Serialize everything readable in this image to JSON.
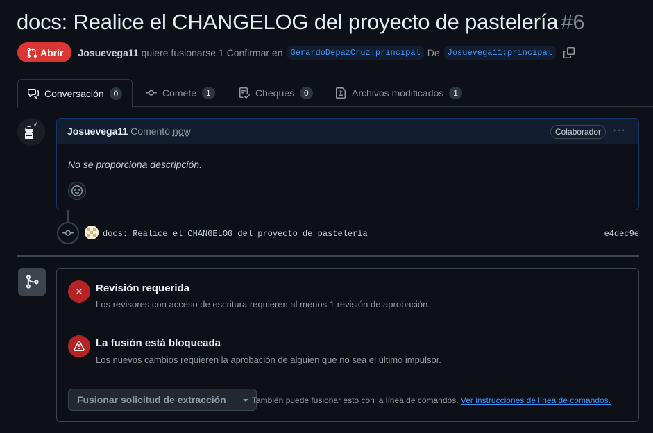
{
  "pr": {
    "title": "docs: Realice el CHANGELOG del proyecto de pastelería",
    "number": "#6",
    "state": "Abrir",
    "author": "Josuevega11",
    "action_text": "quiere fusionarse 1 Confirmar en",
    "base_branch": "GerardoDepazCruz:principal",
    "from_text": "De",
    "head_branch": "Josuevega11:principal"
  },
  "tabs": [
    {
      "label": "Conversación",
      "count": "0",
      "icon": "comment-discussion-icon"
    },
    {
      "label": "Comete",
      "count": "1",
      "icon": "git-commit-icon"
    },
    {
      "label": "Cheques",
      "count": "0",
      "icon": "checklist-icon"
    },
    {
      "label": "Archivos modificados",
      "count": "1",
      "icon": "file-diff-icon"
    }
  ],
  "comment": {
    "author": "Josuevega11",
    "verb": "Comentó",
    "time": "now",
    "role_badge": "Colaborador",
    "body": "No se proporciona descripción."
  },
  "commit": {
    "message": "docs: Realice el CHANGELOG del proyecto de pastelería",
    "sha": "e4dec9e"
  },
  "merge": {
    "review": {
      "title": "Revisión requerida",
      "desc": "Los revisores con acceso de escritura requieren al menos 1 revisión de aprobación."
    },
    "blocked": {
      "title": "La fusión está bloqueada",
      "desc": "Los nuevos cambios requieren la aprobación de alguien que no sea el último impulsor."
    },
    "button_label": "Fusionar solicitud de extracción",
    "note": "También puede fusionar esto con la línea de comandos.",
    "link": "Ver instrucciones de línea de comandos."
  },
  "colors": {
    "background": "#0d1117",
    "danger": "#da3633",
    "link": "#4493f8",
    "border": "#3d444d"
  }
}
